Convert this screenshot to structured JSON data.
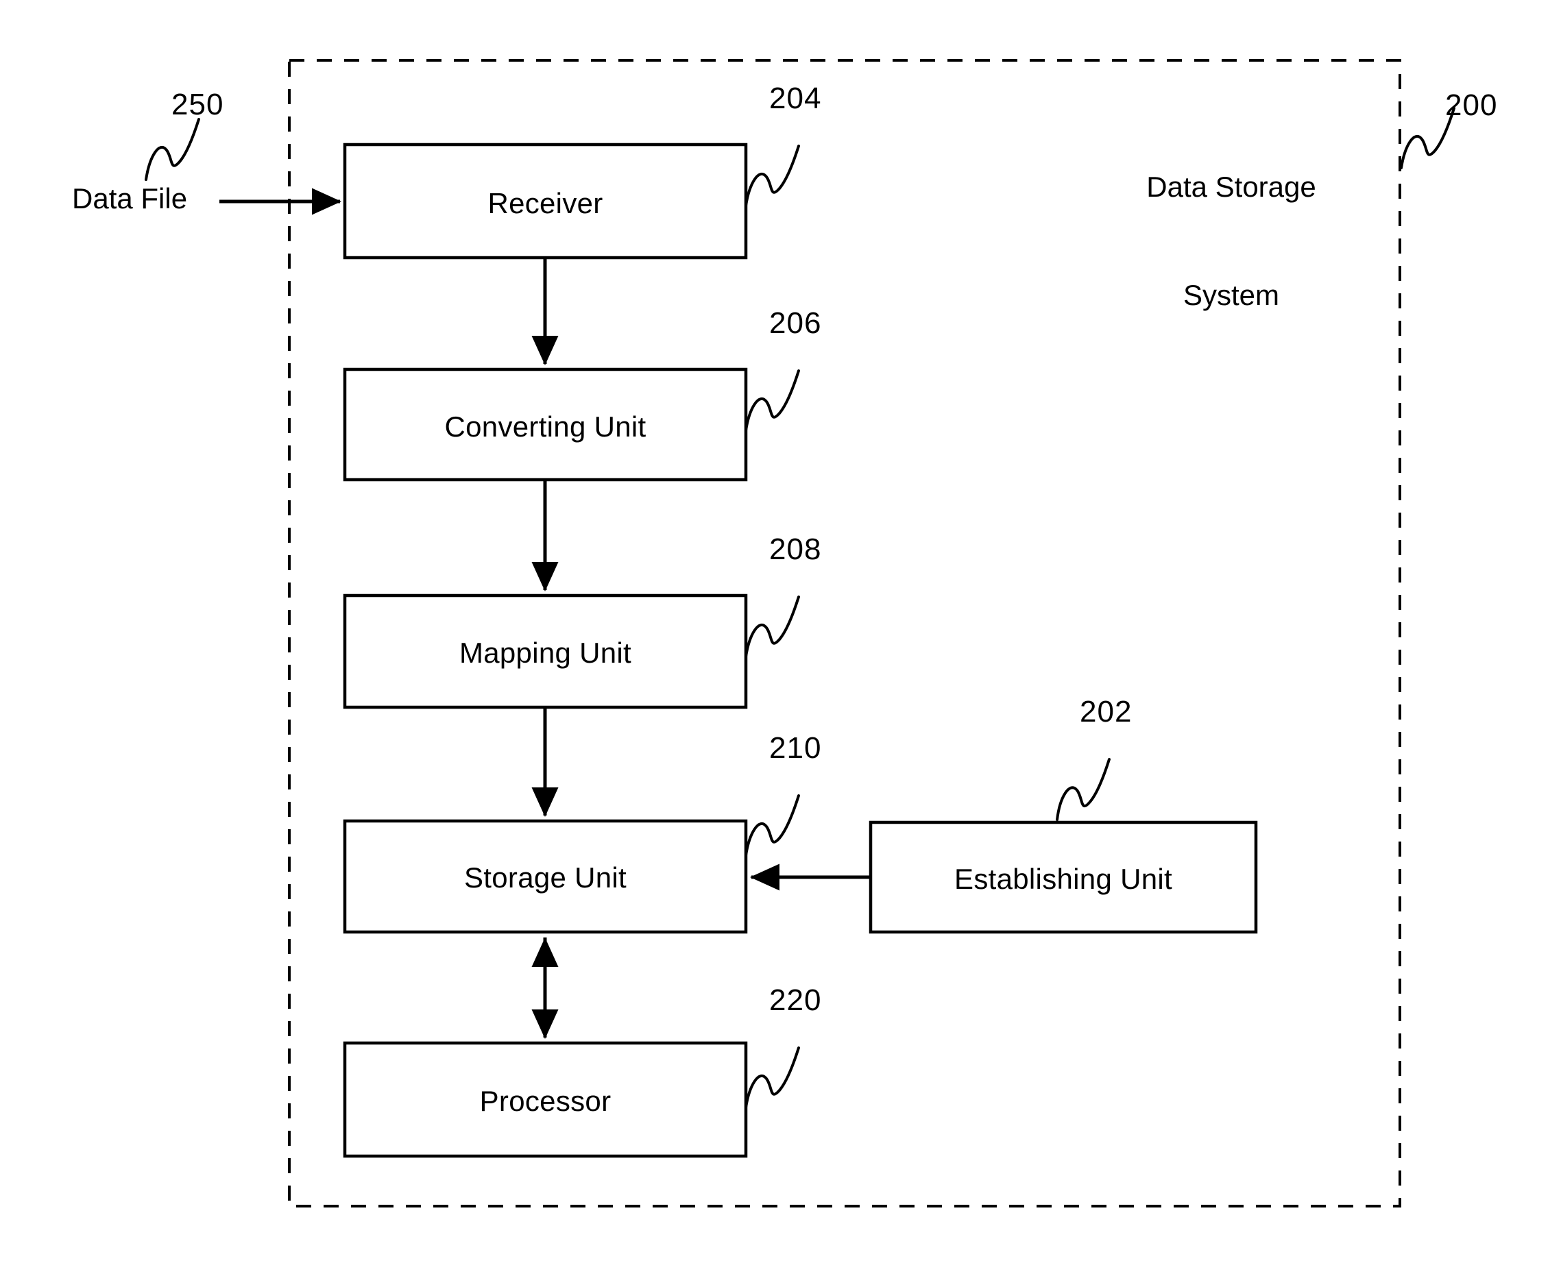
{
  "figure": {
    "type": "patent-block-diagram",
    "system_title": "Data Storage System",
    "system_title_line1": "Data Storage",
    "system_title_line2": "System",
    "system_ref": "200",
    "input_label": "Data File",
    "input_ref": "250",
    "boundary_style": "dashed"
  },
  "blocks": [
    {
      "id": "receiver",
      "label": "Receiver",
      "ref": "204"
    },
    {
      "id": "converting",
      "label": "Converting Unit",
      "ref": "206"
    },
    {
      "id": "mapping",
      "label": "Mapping Unit",
      "ref": "208"
    },
    {
      "id": "storage",
      "label": "Storage Unit",
      "ref": "210"
    },
    {
      "id": "processor",
      "label": "Processor",
      "ref": "220"
    },
    {
      "id": "establishing",
      "label": "Establishing Unit",
      "ref": "202"
    }
  ],
  "connections": [
    {
      "from": "Data File",
      "to": "Receiver",
      "arrow": "single"
    },
    {
      "from": "Receiver",
      "to": "Converting Unit",
      "arrow": "single"
    },
    {
      "from": "Converting Unit",
      "to": "Mapping Unit",
      "arrow": "single"
    },
    {
      "from": "Mapping Unit",
      "to": "Storage Unit",
      "arrow": "single"
    },
    {
      "from": "Establishing Unit",
      "to": "Storage Unit",
      "arrow": "single"
    },
    {
      "from": "Storage Unit",
      "to": "Processor",
      "arrow": "double"
    }
  ],
  "colors": {
    "stroke": "#000000",
    "background": "#ffffff",
    "text": "#000000"
  }
}
